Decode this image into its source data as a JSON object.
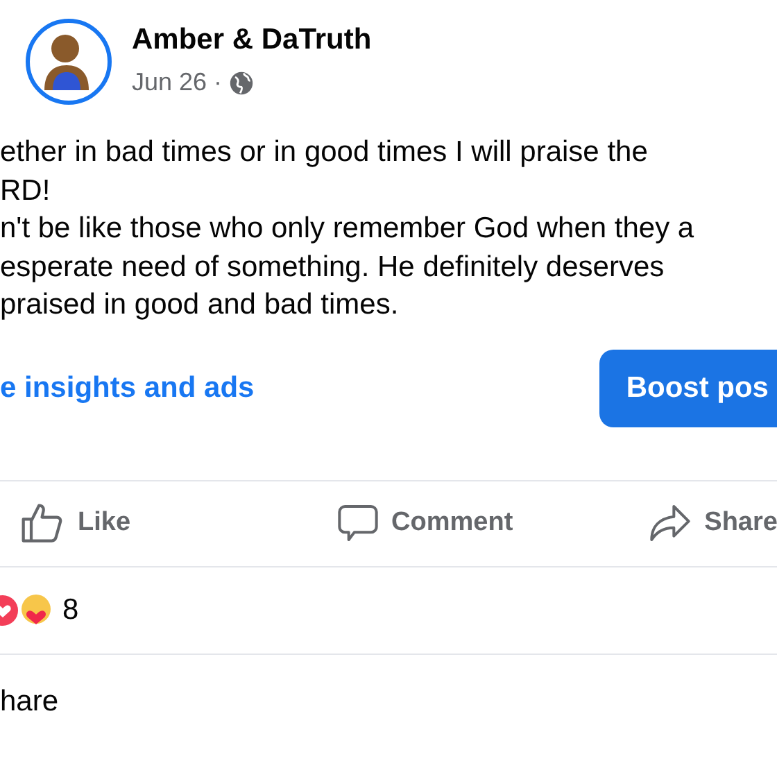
{
  "post": {
    "author": "Amber & DaTruth",
    "date": "Jun 26",
    "separator": "·",
    "body_lines": [
      "ether in bad times or in good times I will praise the",
      "RD!",
      "n't be like those who only remember God when they a",
      "esperate need of something. He definitely deserves",
      "praised in good and bad times."
    ],
    "insights_link": "e insights and ads",
    "boost_button": "Boost pos",
    "actions": [
      {
        "kind": "like",
        "label": "Like"
      },
      {
        "kind": "comment",
        "label": "Comment"
      },
      {
        "kind": "share",
        "label": "Share"
      }
    ],
    "reaction_count": "8",
    "next_label": "hare"
  }
}
